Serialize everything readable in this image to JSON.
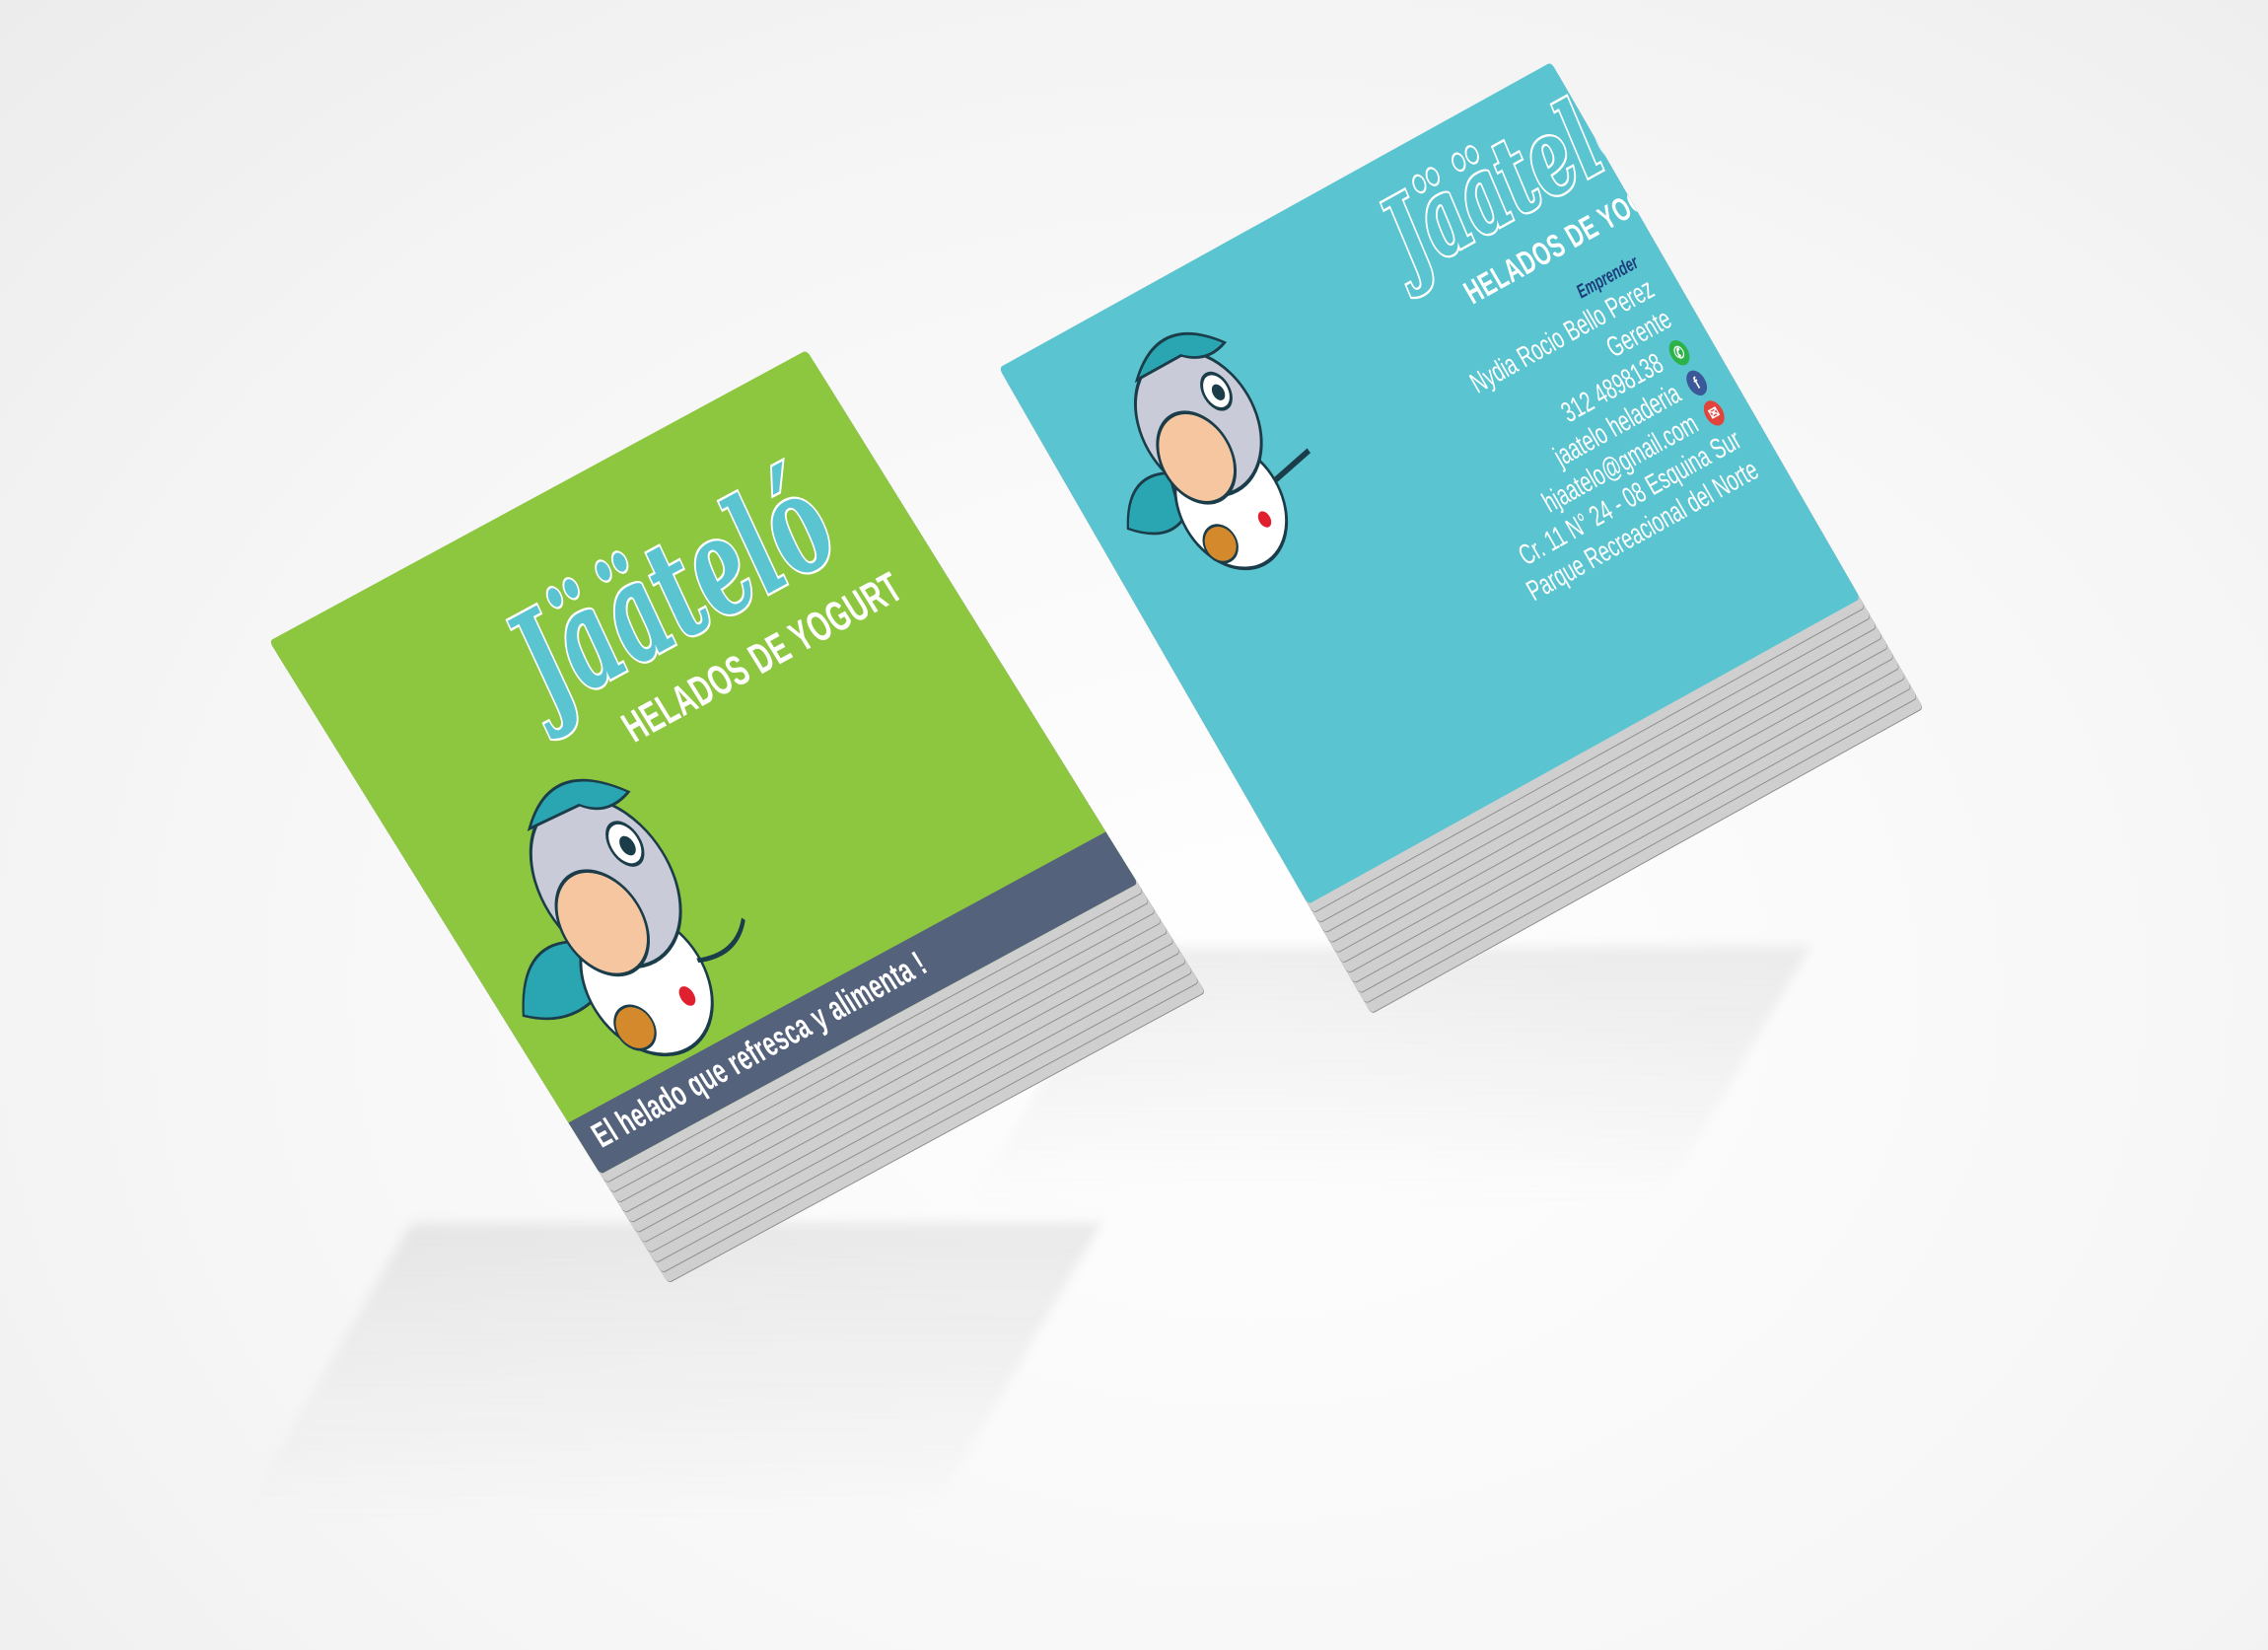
{
  "green_card": {
    "logo": "Jääteló",
    "subtitle": "HELADOS DE YOGURT",
    "tagline": "El helado que refresca y alimenta !",
    "background_color": "#8dc63f",
    "strip_color": "#55627c"
  },
  "blue_card": {
    "logo": "Jääteló",
    "subtitle": "HELADOS DE YOGURT",
    "name": "Nydia Rocio Bello Perez",
    "role": "Gerente",
    "phone": "312 4898138",
    "facebook": "jaatelo heladeria",
    "email": "hjaatelo@gmail.com",
    "address": "Cr. 11 N° 24 - 08 Esquina Sur",
    "location": "Parque Recreacional del Norte",
    "partner_logo_text": "Emprender",
    "background_color": "#5bc4d1"
  },
  "icons": {
    "whatsapp": "whatsapp-icon",
    "facebook": "facebook-icon",
    "email": "mail-icon",
    "mascot": "cow-mascot-illustration"
  }
}
